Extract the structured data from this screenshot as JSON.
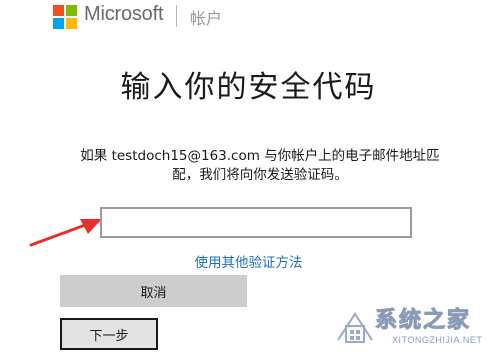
{
  "header": {
    "logo_icon": "microsoft-logo-icon",
    "logo_colors": [
      "#f25022",
      "#7fba00",
      "#00a4ef",
      "#ffb900"
    ],
    "brand_name": "Microsoft",
    "section_label": "帐户"
  },
  "main": {
    "title": "输入你的安全代码",
    "description_line1": "如果 testdoch15@163.com 与你帐户上的电子邮件地址匹",
    "description_line2": "配，我们将向你发送验证码。",
    "code_input_value": "",
    "alt_verify_link": "使用其他验证方法",
    "cancel_button": "取消",
    "next_button": "下一步"
  },
  "annotation": {
    "arrow_icon": "red-arrow-icon",
    "arrow_color": "#e8302a"
  },
  "watermark": {
    "text": "系统之家",
    "url_text": "XITONGZHIJIA.NET",
    "color": "#8a9bb8"
  },
  "colors": {
    "link": "#1e6fc8",
    "cancel_bg": "#cdcdcd",
    "next_bg": "#e3e3e3"
  }
}
